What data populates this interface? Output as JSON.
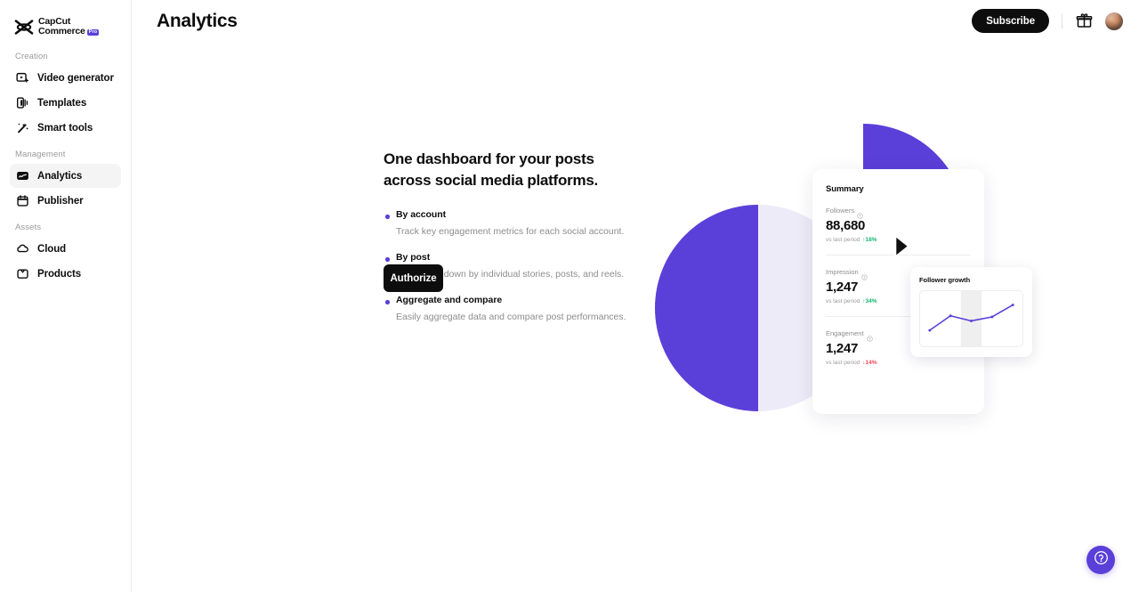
{
  "brand": {
    "name_line1": "CapCut",
    "name_line2": "Commerce",
    "pro_badge": "Pro"
  },
  "sidebar": {
    "sections": [
      {
        "label": "Creation",
        "items": [
          {
            "label": "Video generator",
            "icon": "video-generator-icon",
            "active": false
          },
          {
            "label": "Templates",
            "icon": "templates-icon",
            "active": false
          },
          {
            "label": "Smart tools",
            "icon": "smart-tools-icon",
            "active": false
          }
        ]
      },
      {
        "label": "Management",
        "items": [
          {
            "label": "Analytics",
            "icon": "analytics-icon",
            "active": true
          },
          {
            "label": "Publisher",
            "icon": "publisher-calendar-icon",
            "active": false
          }
        ]
      },
      {
        "label": "Assets",
        "items": [
          {
            "label": "Cloud",
            "icon": "cloud-icon",
            "active": false
          },
          {
            "label": "Products",
            "icon": "products-icon",
            "active": false
          }
        ]
      }
    ]
  },
  "topbar": {
    "title": "Analytics",
    "subscribe_label": "Subscribe",
    "gift_icon": "gift-icon",
    "avatar_icon": "user-avatar"
  },
  "hero": {
    "heading": "One dashboard for your posts across social media platforms.",
    "features": [
      {
        "title": "By account",
        "desc": "Track key engagement metrics for each social account."
      },
      {
        "title": "By post",
        "desc": "Break data down by individual stories, posts, and reels."
      },
      {
        "title": "Aggregate and compare",
        "desc": "Easily aggregate data and compare post performances."
      }
    ],
    "authorize_label": "Authorize"
  },
  "illustration": {
    "summary_card": {
      "title": "Summary",
      "metrics": [
        {
          "label": "Followers",
          "value": "88,680",
          "compare_text": "vs last period",
          "delta": "18%",
          "direction": "up",
          "arrow": "↑"
        },
        {
          "label": "Impression",
          "value": "1,247",
          "compare_text": "vs last period",
          "delta": "34%",
          "direction": "up",
          "arrow": "↑"
        },
        {
          "label": "Engagement",
          "value": "1,247",
          "compare_text": "vs last period",
          "delta": "14%",
          "direction": "down",
          "arrow": "↓"
        }
      ]
    },
    "growth_card": {
      "title": "Follower growth"
    }
  },
  "chart_data": {
    "type": "line",
    "title": "Follower growth",
    "x": [
      1,
      2,
      3,
      4,
      5
    ],
    "values": [
      18,
      58,
      44,
      55,
      88
    ],
    "series": [
      {
        "name": "Follower growth",
        "values": [
          18,
          58,
          44,
          55,
          88
        ]
      }
    ],
    "categories": [
      "1",
      "2",
      "3",
      "4",
      "5"
    ],
    "xlabel": "",
    "ylabel": "",
    "ylim": [
      0,
      100
    ],
    "grid": false,
    "legend": "none",
    "line_color": "#5B3FD9",
    "highlight_band": {
      "from": 2.5,
      "to": 3.5,
      "color": "#efefef"
    }
  },
  "colors": {
    "accent_purple": "#5B3FD9",
    "lavender": "#EEEBF8",
    "positive_green": "#13b871",
    "negative_red": "#f2485b",
    "dark": "#0d0d0d"
  },
  "help": {
    "icon": "question-mark-help-icon"
  }
}
